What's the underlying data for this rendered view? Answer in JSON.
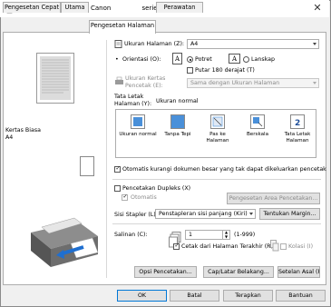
{
  "window": {
    "title": "Preferensi Pencetakan Canon ",
    "title_suffix": "series"
  },
  "tabs": [
    {
      "label": "Pengesetan Cepat"
    },
    {
      "label": "Utama"
    },
    {
      "label": "Pengesetan Halaman"
    },
    {
      "label": "Perawatan"
    }
  ],
  "preview": {
    "media_label": "Kertas Biasa",
    "size_label": "A4"
  },
  "page_size": {
    "label": "Ukuran Halaman (Z):",
    "value": "A4"
  },
  "orientation": {
    "label": "Orientasi (O):",
    "portrait": "Potret",
    "landscape": "Lanskap",
    "rotate_label": "Putar 180 derajat (T)"
  },
  "printer_paper": {
    "label_line1": "Ukuran Kertas",
    "label_line2": "Pencetak (E):",
    "value": "Sama dengan Ukuran Halaman"
  },
  "page_layout": {
    "label_line1": "Tata Letak",
    "label_line2": "Halaman (Y):",
    "current": "Ukuran normal",
    "options": [
      {
        "label": "Ukuran normal"
      },
      {
        "label": "Tanpa Tepi"
      },
      {
        "label": "Pas ke Halaman"
      },
      {
        "label": "Berskala"
      },
      {
        "label": "Tata Letak Halaman"
      }
    ]
  },
  "auto_reduce": {
    "label": "Otomatis kurangi dokumen besar yang tak dapat dikeluarkan pencetak"
  },
  "duplex": {
    "label": "Pencetakan Dupleks (X)",
    "auto_label": "Otomatis",
    "area_button": "Pengesetan Area Pencetakan..."
  },
  "stapling": {
    "label": "Sisi Stapler (L):",
    "value": "Penstapleran sisi panjang (Kiri)",
    "margin_button": "Tentukan Margin..."
  },
  "copies": {
    "label": "Salinan (C):",
    "value": "1",
    "range": "(1-999)",
    "reverse_label": "Cetak dari Halaman Terakhir (R)",
    "collate_label": "Kolasi (I)"
  },
  "bottom_buttons": {
    "print_options": "Opsi Pencetakan...",
    "stamp": "Cap/Latar Belakang...",
    "defaults": "Setelan Asal (F)"
  },
  "dialog_buttons": {
    "ok": "OK",
    "cancel": "Batal",
    "apply": "Terapkan",
    "help": "Bantuan"
  }
}
